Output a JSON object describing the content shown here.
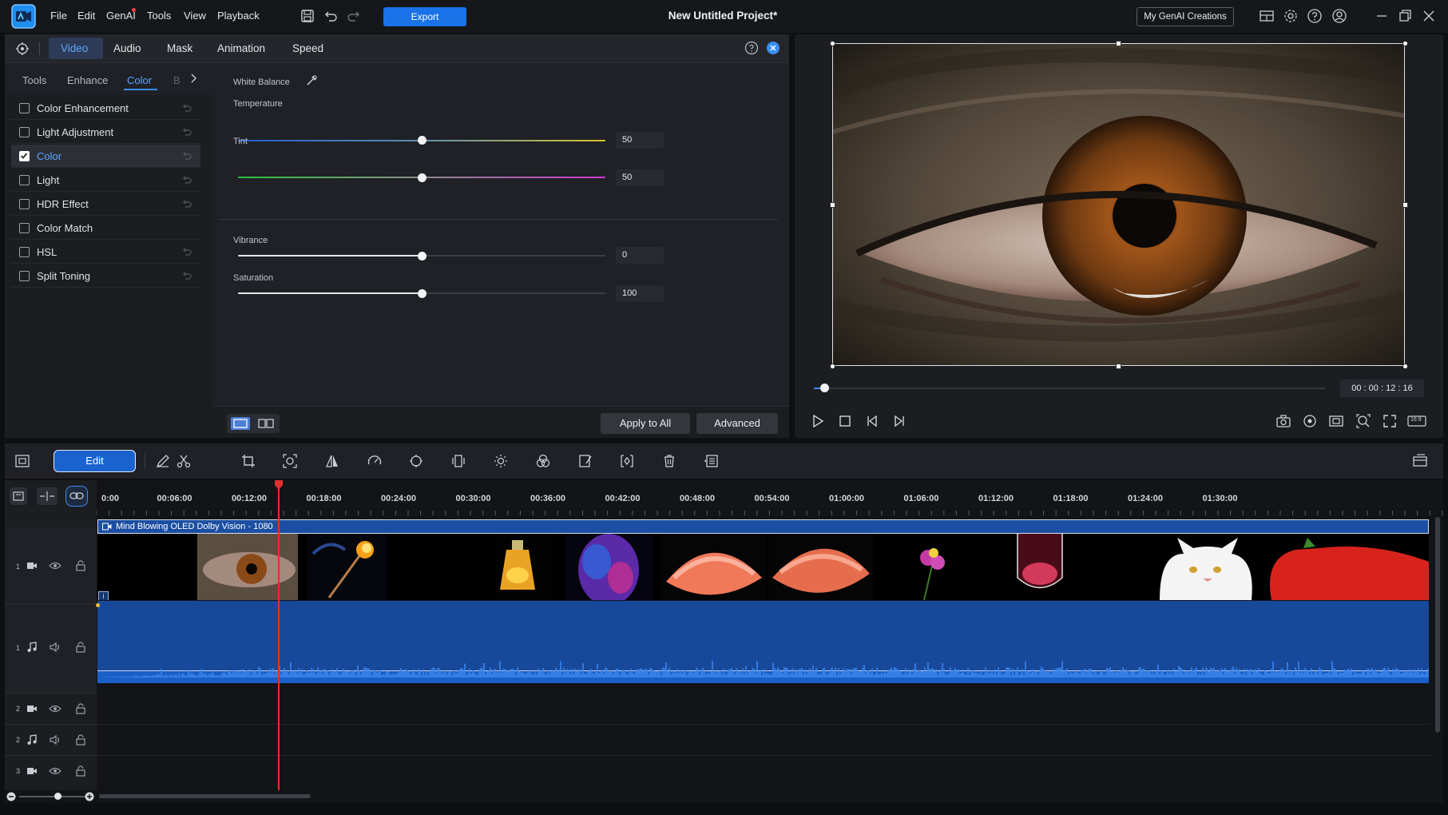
{
  "menu": {
    "items": [
      "File",
      "Edit",
      "GenAI",
      "Tools",
      "View",
      "Playback"
    ],
    "export_label": "Export",
    "project_title": "New Untitled Project*",
    "genai_creations_label": "My GenAI Creations"
  },
  "panel": {
    "main_tabs": [
      "Video",
      "Audio",
      "Mask",
      "Animation",
      "Speed"
    ],
    "sub_tabs": [
      "Tools",
      "Enhance",
      "Color",
      "B"
    ],
    "features": [
      {
        "label": "Color Enhancement",
        "checked": false
      },
      {
        "label": "Light Adjustment",
        "checked": false
      },
      {
        "label": "Color",
        "checked": true
      },
      {
        "label": "Light",
        "checked": false
      },
      {
        "label": "HDR Effect",
        "checked": false
      },
      {
        "label": "Color Match",
        "checked": false
      },
      {
        "label": "HSL",
        "checked": false
      },
      {
        "label": "Split Toning",
        "checked": false
      }
    ],
    "white_balance_label": "White Balance",
    "sliders": [
      {
        "label": "Temperature",
        "value": "50",
        "level": 0.5
      },
      {
        "label": "Tint",
        "value": "50",
        "level": 0.5
      },
      {
        "label": "Vibrance",
        "value": "0",
        "level": 0.5
      },
      {
        "label": "Saturation",
        "value": "100",
        "level": 0.5
      }
    ],
    "apply_all_label": "Apply to All",
    "advanced_label": "Advanced"
  },
  "preview": {
    "timecode": "00 : 00 : 12 : 16",
    "aspect_label": "16:9",
    "scrub_level": 0.02
  },
  "timeline": {
    "edit_label": "Edit",
    "ruler_labels": [
      "0:00",
      "00:06:00",
      "00:12:00",
      "00:18:00",
      "00:24:00",
      "00:30:00",
      "00:36:00",
      "00:42:00",
      "00:48:00",
      "00:54:00",
      "01:00:00",
      "01:06:00",
      "01:12:00",
      "01:18:00",
      "01:24:00",
      "01:30:00"
    ],
    "clip_title": "Mind Blowing OLED Dolby Vision - 1080",
    "track_numbers": [
      "1",
      "1",
      "2",
      "2",
      "3"
    ]
  },
  "colors": {
    "accent": "#1a72e8",
    "active_tab": "#5ea5ff",
    "clip_blue": "#1c4fa3",
    "playhead": "#e03030"
  }
}
